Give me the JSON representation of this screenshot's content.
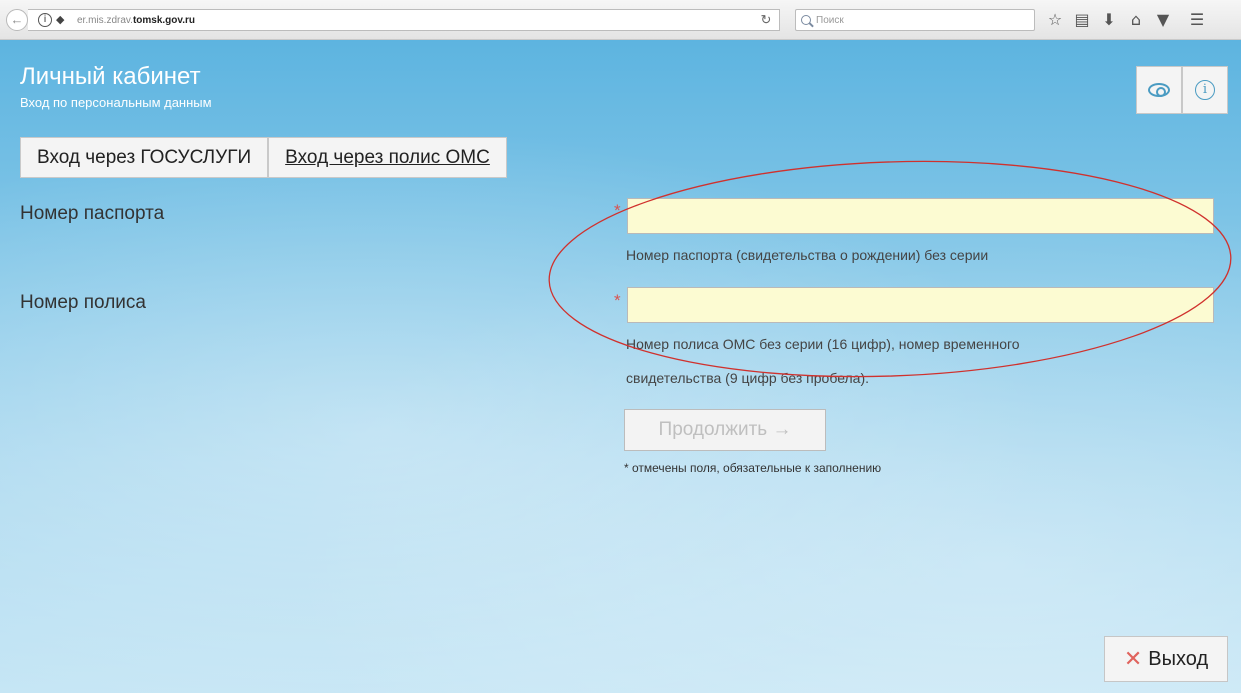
{
  "browser": {
    "url_prefix": "er.mis.zdrav.",
    "url_host": "tomsk.gov.ru",
    "search_placeholder": "Поиск"
  },
  "header": {
    "title": "Личный кабинет",
    "subtitle": "Вход по персональным данным"
  },
  "tabs": [
    {
      "label": "Вход через ГОСУСЛУГИ"
    },
    {
      "label": "Вход через полис ОМС"
    }
  ],
  "form": {
    "passport": {
      "label": "Номер паспорта",
      "required_mark": "*",
      "value": "",
      "hint": "Номер паспорта (свидетельства о рождении) без серии"
    },
    "policy": {
      "label": "Номер полиса",
      "required_mark": "*",
      "value": "",
      "hint_line1": "Номер полиса ОМС без серии (16 цифр), номер временного",
      "hint_line2": "свидетельства (9 цифр без пробела)."
    },
    "continue_label": "Продолжить →",
    "required_note": "* отмечены поля, обязательные к заполнению"
  },
  "exit_label": "Выход",
  "colors": {
    "input_bg": "#fcfbd2",
    "required": "#d9534f",
    "annotation": "#d0312d"
  }
}
